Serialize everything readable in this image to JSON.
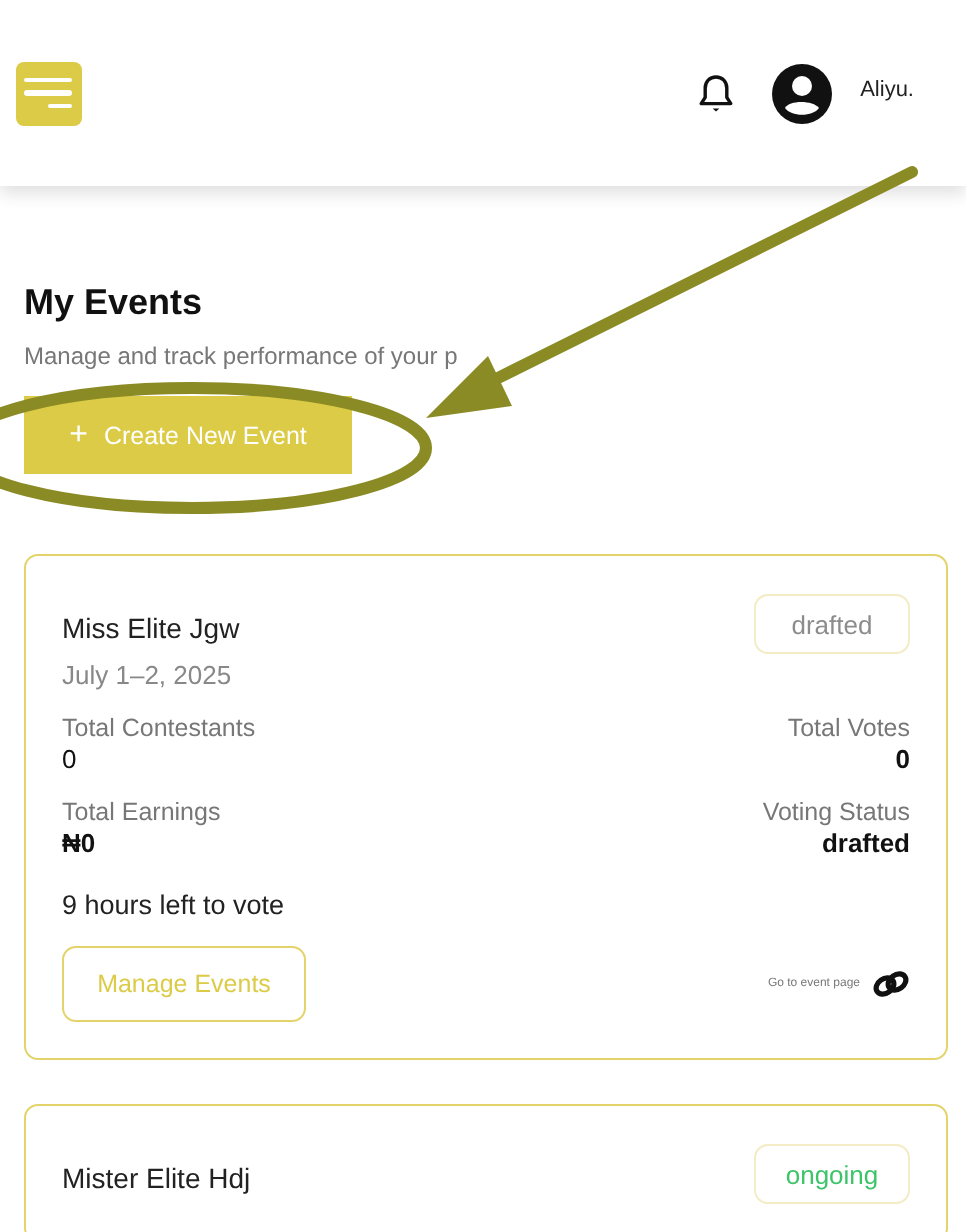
{
  "header": {
    "user_name": "Aliyu."
  },
  "page": {
    "title": "My Events",
    "subtitle": "Manage and track performance of your p",
    "create_button": {
      "icon": "+",
      "label": "Create New Event"
    }
  },
  "events": [
    {
      "name": "Miss Elite Jgw",
      "status": {
        "label": "drafted",
        "color": "#8c8c8c"
      },
      "date": "July 1–2, 2025",
      "stats": [
        {
          "label": "Total Contestants",
          "value": "0"
        },
        {
          "label": "Total Votes",
          "value": "0"
        },
        {
          "label": "Total Earnings",
          "value": "₦0"
        },
        {
          "label": "Voting Status",
          "value": "drafted"
        }
      ],
      "countdown": "9 hours left to vote",
      "manage_button": "Manage Events",
      "event_link": "Go to event page"
    },
    {
      "name": "Mister Elite Hdj",
      "status": {
        "label": "ongoing",
        "color": "#3cc468"
      }
    }
  ]
}
